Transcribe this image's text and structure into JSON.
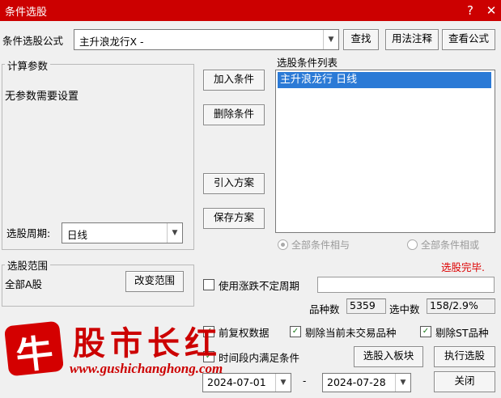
{
  "window": {
    "title": "条件选股"
  },
  "formula": {
    "label": "条件选股公式",
    "value": "主升浪龙行X -",
    "find_btn": "查找",
    "usage_btn": "用法注释",
    "view_btn": "查看公式"
  },
  "params": {
    "group_title": "计算参数",
    "text": "无参数需要设置",
    "period_label": "选股周期:",
    "period_value": "日线"
  },
  "actions": {
    "add": "加入条件",
    "delete": "删除条件",
    "import": "引入方案",
    "save": "保存方案"
  },
  "conditions": {
    "label": "选股条件列表",
    "items": [
      "主升浪龙行  日线"
    ],
    "radio_and": "全部条件相与",
    "radio_or": "全部条件相或"
  },
  "status": {
    "text": "选股完毕.",
    "color": "#dd0000"
  },
  "scope": {
    "group_title": "选股范围",
    "value": "全部A股",
    "change_btn": "改变范围"
  },
  "period_option": {
    "label": "使用涨跌不定周期",
    "value": ""
  },
  "stats": {
    "count_label": "品种数",
    "count_value": "5359",
    "selected_label": "选中数",
    "selected_value": "158/2.9%"
  },
  "options": {
    "prefix": "前复权数据",
    "exclude_untraded": "剔除当前未交易品种",
    "exclude_st": "剔除ST品种",
    "time_range": "时间段内满足条件"
  },
  "dates": {
    "start": "2024-07-01",
    "sep": "-",
    "end": "2024-07-28"
  },
  "buttons": {
    "to_block": "选股入板块",
    "execute": "执行选股",
    "close": "关闭"
  },
  "watermark": {
    "char": "牛",
    "name": "股市长红",
    "url": "www.gushichanghong.com"
  }
}
